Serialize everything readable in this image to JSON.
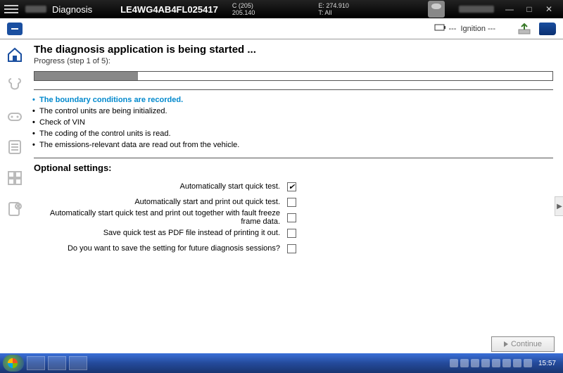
{
  "titlebar": {
    "app_title": "Diagnosis",
    "vin": "LE4WG4AB4FL025417",
    "meta_c": "C (205)",
    "meta_km": "205.140",
    "meta_e": "E: 274.910",
    "meta_t": "T: All"
  },
  "toolbar": {
    "battery": "--- ",
    "ignition": "Ignition ---"
  },
  "page": {
    "title": "The diagnosis application is being started ...",
    "progress_label": "Progress (step 1 of 5):",
    "progress_percent": 20
  },
  "steps": [
    "The boundary conditions are recorded.",
    "The control units are being initialized.",
    "Check of VIN",
    "The coding of the control units is read.",
    "The emissions-relevant data are read out from the vehicle."
  ],
  "optional": {
    "title": "Optional settings:",
    "rows": [
      {
        "label": "Automatically start quick test.",
        "checked": true
      },
      {
        "label": "Automatically start and print out quick test.",
        "checked": false
      },
      {
        "label": "Automatically start quick test and print out together with fault freeze frame data.",
        "checked": false
      },
      {
        "label": "Save quick test as PDF file instead of printing it out.",
        "checked": false
      },
      {
        "label": "Do you want to save the setting for future diagnosis sessions?",
        "checked": false
      }
    ]
  },
  "buttons": {
    "continue": "Continue"
  },
  "taskbar": {
    "clock": "15:57"
  }
}
